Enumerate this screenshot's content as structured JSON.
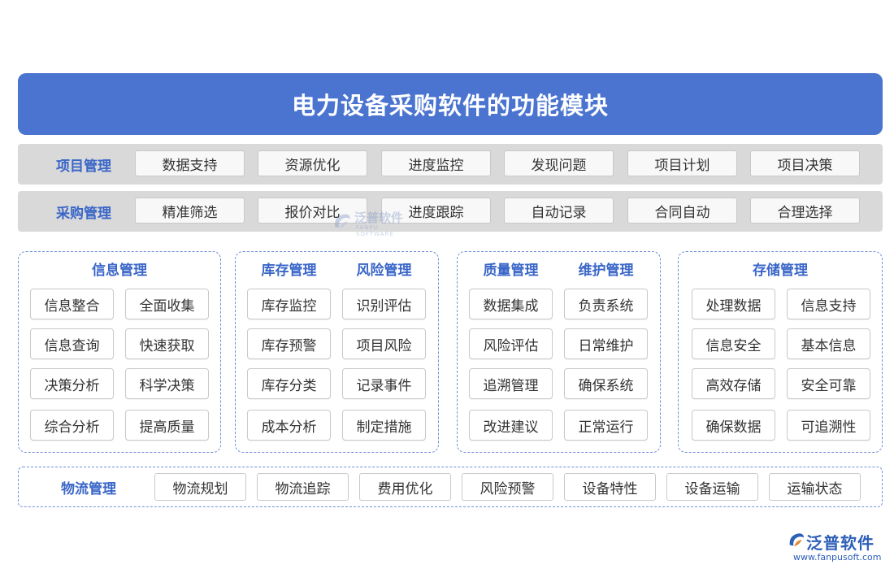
{
  "title": "电力设备采购软件的功能模块",
  "bands": [
    {
      "label": "项目管理",
      "items": [
        "数据支持",
        "资源优化",
        "进度监控",
        "发现问题",
        "项目计划",
        "项目决策"
      ]
    },
    {
      "label": "采购管理",
      "items": [
        "精准筛选",
        "报价对比",
        "进度跟踪",
        "自动记录",
        "合同自动",
        "合理选择"
      ]
    }
  ],
  "groups": [
    {
      "headers": [
        "信息管理"
      ],
      "cells": [
        "信息整合",
        "全面收集",
        "信息查询",
        "快速获取",
        "决策分析",
        "科学决策",
        "综合分析",
        "提高质量"
      ]
    },
    {
      "headers": [
        "库存管理",
        "风险管理"
      ],
      "cells": [
        "库存监控",
        "识别评估",
        "库存预警",
        "项目风险",
        "库存分类",
        "记录事件",
        "成本分析",
        "制定措施"
      ]
    },
    {
      "headers": [
        "质量管理",
        "维护管理"
      ],
      "cells": [
        "数据集成",
        "负责系统",
        "风险评估",
        "日常维护",
        "追溯管理",
        "确保系统",
        "改进建议",
        "正常运行"
      ]
    },
    {
      "headers": [
        "存储管理"
      ],
      "cells": [
        "处理数据",
        "信息支持",
        "信息安全",
        "基本信息",
        "高效存储",
        "安全可靠",
        "确保数据",
        "可追溯性"
      ]
    }
  ],
  "logistics": {
    "label": "物流管理",
    "items": [
      "物流规划",
      "物流追踪",
      "费用优化",
      "风险预警",
      "设备特性",
      "设备运输",
      "运输状态"
    ]
  },
  "watermark": {
    "name": "泛普软件",
    "sub": "FANPU SOFTWARE"
  },
  "logo": {
    "name": "泛普软件",
    "url": "www.fanpusoft.com"
  },
  "colors": {
    "title_bg": "#4a74d0",
    "accent": "#3a66c8",
    "band_bg": "#d9d9d9"
  }
}
